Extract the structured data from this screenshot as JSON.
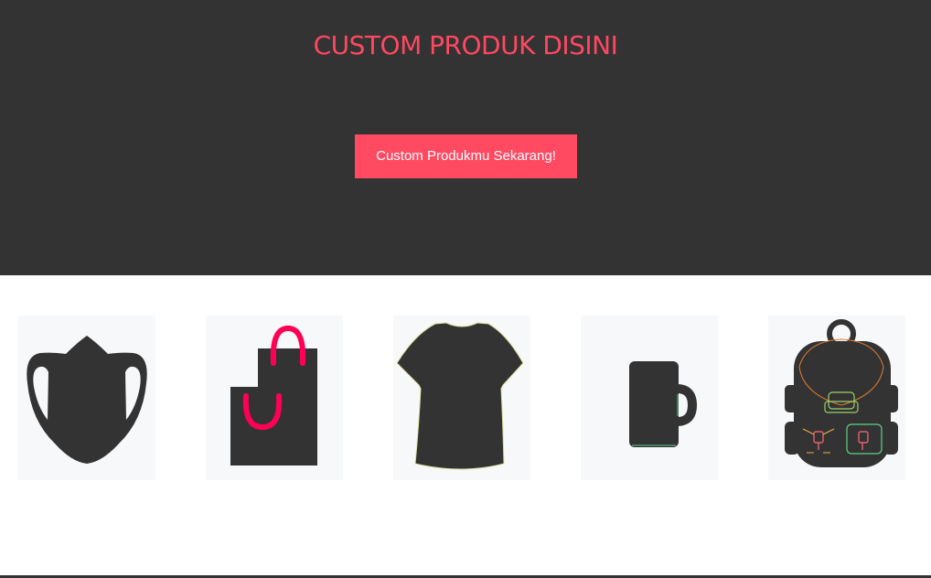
{
  "hero": {
    "title": "CUSTOM PRODUK DISINI",
    "cta_label": "Custom Produkmu Sekarang!"
  },
  "colors": {
    "hero_background": "#333333",
    "accent": "#ff4a62",
    "product_silhouette": "#333333",
    "bag_handle": "#ff0055"
  },
  "products": [
    {
      "icon": "face-mask-icon"
    },
    {
      "icon": "shopping-bag-icon"
    },
    {
      "icon": "t-shirt-icon"
    },
    {
      "icon": "mug-icon"
    },
    {
      "icon": "backpack-icon"
    }
  ]
}
